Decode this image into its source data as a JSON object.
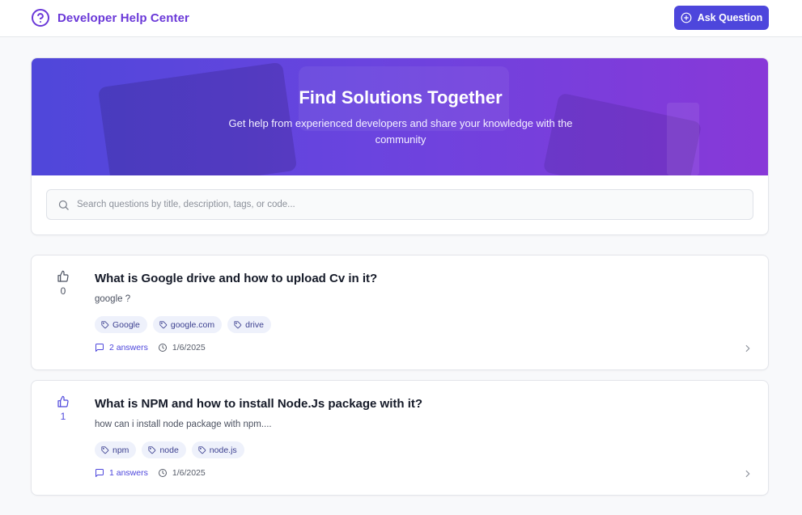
{
  "header": {
    "brand_title": "Developer Help Center",
    "brand_icon": "help-circle-icon",
    "ask_button": "Ask Question",
    "accent": "#4d46dc",
    "brand_color": "#6a38d8"
  },
  "hero": {
    "title": "Find Solutions Together",
    "subtitle": "Get help from experienced developers and share your knowledge with the community",
    "gradient": [
      "#4f47da",
      "#8838d8"
    ]
  },
  "search": {
    "placeholder": "Search questions by title, description, tags, or code..."
  },
  "questions": [
    {
      "votes": "0",
      "title": "What is Google drive and how to upload Cv in it?",
      "description": "google ?",
      "tags": [
        "Google",
        "google.com",
        "drive"
      ],
      "answers": "2 answers",
      "date": "1/6/2025"
    },
    {
      "votes": "1",
      "title": "What is NPM and how to install Node.Js package with it?",
      "description": "how can i install node package with npm....",
      "tags": [
        "npm",
        "node",
        "node.js"
      ],
      "answers": "1 answers",
      "date": "1/6/2025"
    }
  ]
}
